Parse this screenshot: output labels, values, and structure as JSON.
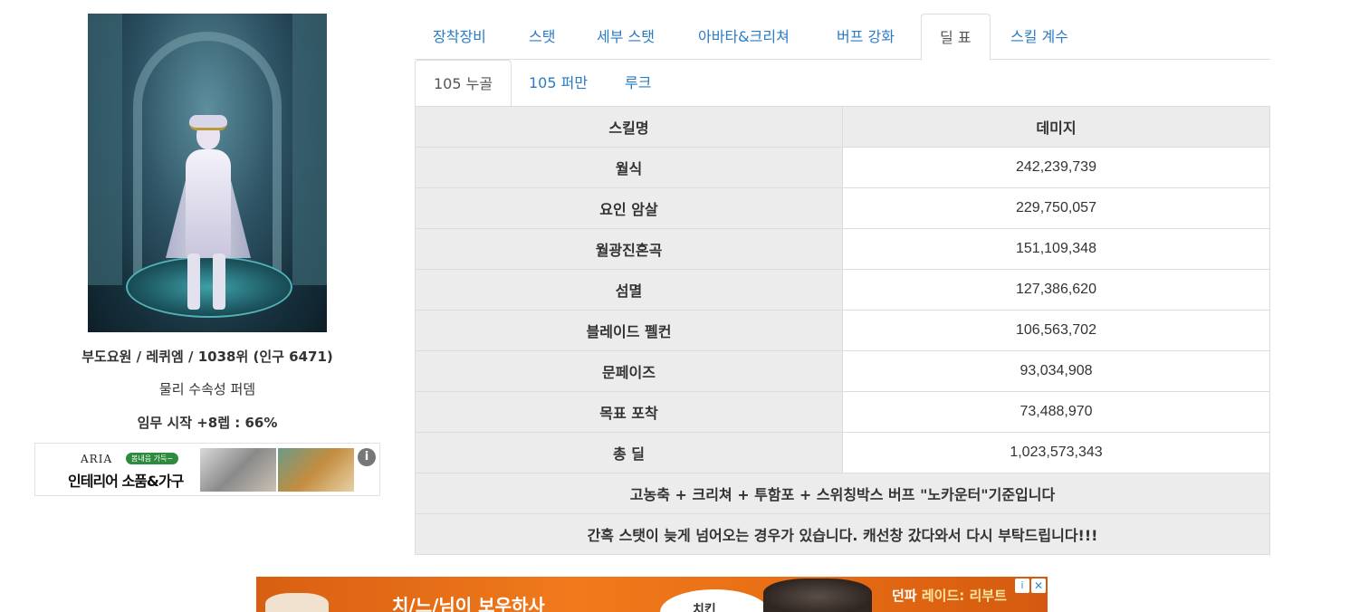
{
  "profile": {
    "line1": "부도요원 / 레퀴엠 / 1038위 (인구 6471)",
    "line2": "물리 수속성 퍼뎀",
    "line3": "임무 시작 +8렙 : 66%"
  },
  "ad_small": {
    "brand": "ARIA",
    "badge": "봄내음 가득~",
    "headline": "인테리어 소품&가구",
    "info_glyph": "i"
  },
  "tabs_main": [
    "장착장비",
    "스탯",
    "세부 스탯",
    "아바타&크리쳐",
    "버프 강화",
    "딜 표",
    "스킬 계수"
  ],
  "tabs_main_active": "딜 표",
  "tabs_sub": [
    "105 누골",
    "105 퍼만",
    "루크"
  ],
  "tabs_sub_active": "105 누골",
  "table": {
    "headers": [
      "스킬명",
      "데미지"
    ],
    "rows": [
      {
        "skill": "월식",
        "damage": "242,239,739"
      },
      {
        "skill": "요인 암살",
        "damage": "229,750,057"
      },
      {
        "skill": "월광진혼곡",
        "damage": "151,109,348"
      },
      {
        "skill": "섬멸",
        "damage": "127,386,620"
      },
      {
        "skill": "블레이드 펠컨",
        "damage": "106,563,702"
      },
      {
        "skill": "문페이즈",
        "damage": "93,034,908"
      },
      {
        "skill": "목표 포착",
        "damage": "73,488,970"
      },
      {
        "skill": "총 딜",
        "damage": "1,023,573,343"
      }
    ],
    "notes": [
      "고농축 + 크리쳐 + 투함포 + 스위칭박스 버프 \"노카운터\"기준입니다",
      "간혹 스탯이 늦게 넘어오는 경우가 있습니다. 캐선창 갔다와서 다시 부탁드립니다!!!"
    ]
  },
  "ad_bottom": {
    "text_left": "치/느/님이 보우하사",
    "oval_text": "치킨",
    "text_right_prefix": "던파",
    "text_right_highlight": "레이드: 리부트",
    "adchoice_glyph": "i",
    "close_glyph": "✕"
  },
  "colors": {
    "link": "#2a7bc4",
    "table_shade": "#ececec",
    "ad_orange": "#f07a1c"
  }
}
